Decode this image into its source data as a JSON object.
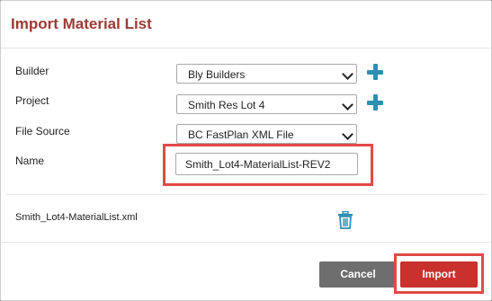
{
  "dialog": {
    "title": "Import Material List",
    "fields": {
      "builder": {
        "label": "Builder",
        "value": "Bly Builders"
      },
      "project": {
        "label": "Project",
        "value": "Smith Res Lot 4"
      },
      "file_source": {
        "label": "File Source",
        "value": "BC FastPlan XML File"
      },
      "name": {
        "label": "Name",
        "value": "Smith_Lot4-MaterialList-REV2"
      }
    },
    "file_name": "Smith_Lot4-MaterialList.xml",
    "cancel_label": "Cancel",
    "import_label": "Import"
  },
  "colors": {
    "title": "#9b3a36",
    "accent_icon": "#2c8fb3",
    "import_button": "#c8312c",
    "cancel_button": "#6e6e6e",
    "highlight": "#e24a47"
  }
}
